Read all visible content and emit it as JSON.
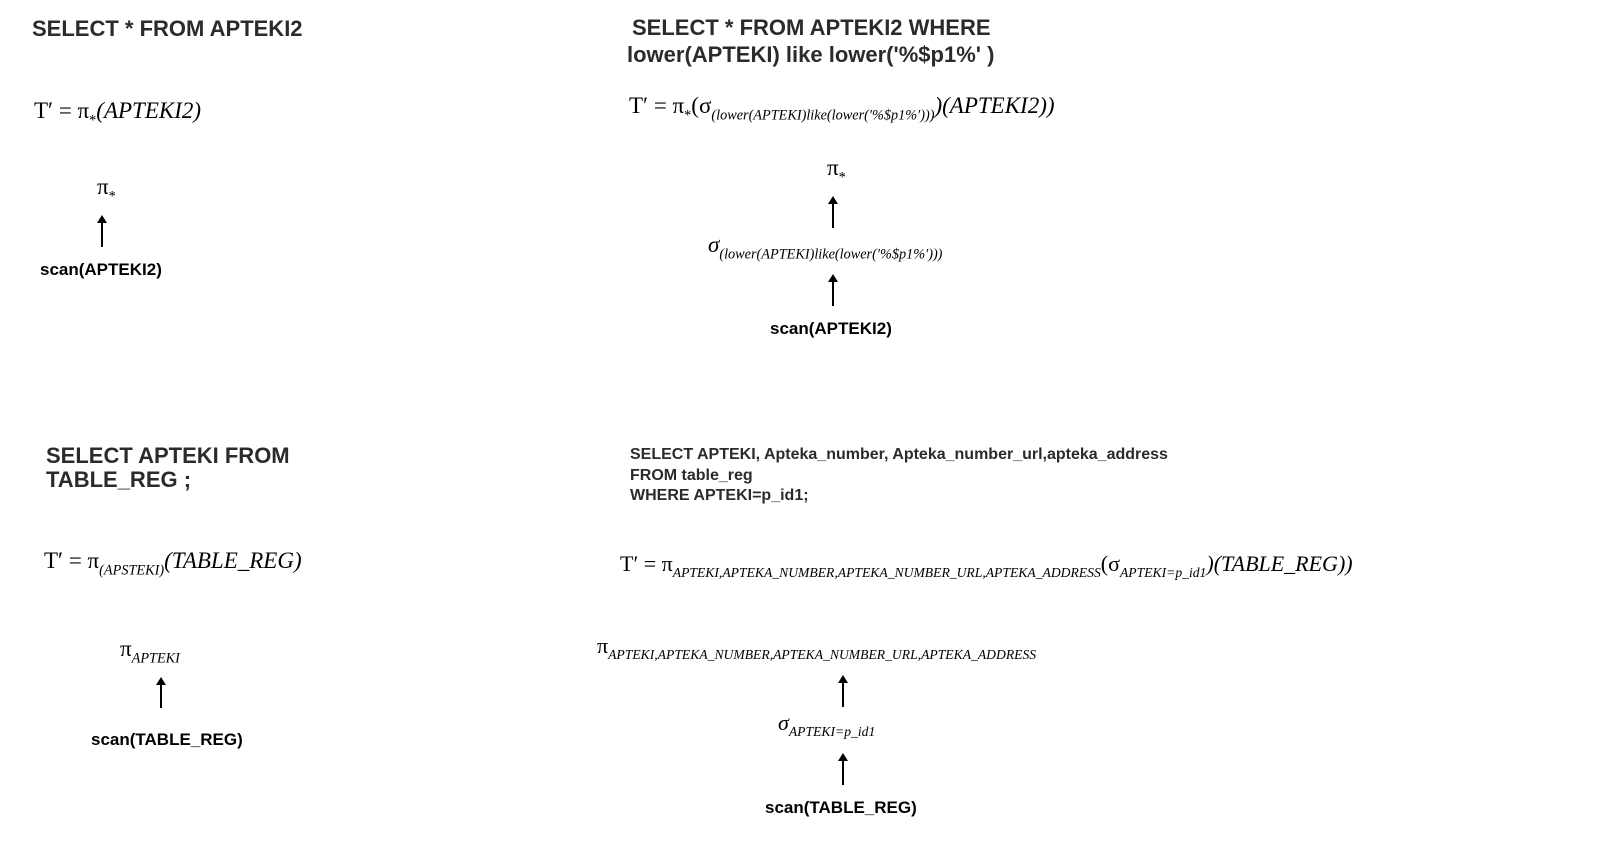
{
  "q1": {
    "sql": "SELECT * FROM APTEKI2",
    "eq": {
      "lhs": "T′ = π",
      "proj_sub": "*",
      "arg": "(APTEKI2)"
    },
    "tree": {
      "proj": "π",
      "proj_sub": "*",
      "scan": "scan(APTEKI2)"
    }
  },
  "q2": {
    "sql_line1": "SELECT * FROM APTEKI2 WHERE",
    "sql_line2": "lower(APTEKI) like lower('%$p1%' )",
    "eq": {
      "lhs": "T′ = π",
      "proj_sub": "*",
      "open": "(σ",
      "sel_sub": "(lower(APTEKI)like(lower(′%$p1%′)))",
      "rest": ")(APTEKI2))"
    },
    "tree": {
      "proj": "π",
      "proj_sub": "*",
      "sel": "σ",
      "sel_sub": "(lower(APTEKI)like(lower(′%$p1%′)))",
      "scan": "scan(APTEKI2)"
    }
  },
  "q3": {
    "sql_line1": "SELECT APTEKI FROM",
    "sql_line2": "TABLE_REG ;",
    "eq": {
      "lhs": "T′ = π",
      "proj_sub": "(APSTEKI)",
      "arg": "(TABLE_REG)"
    },
    "tree": {
      "proj": "π",
      "proj_sub": "APTEKI",
      "scan": "scan(TABLE_REG)"
    }
  },
  "q4": {
    "sql_line1": "SELECT APTEKI, Apteka_number, Apteka_number_url,apteka_address",
    "sql_line2": "FROM table_reg",
    "sql_line3": "WHERE APTEKI=p_id1;",
    "eq": {
      "lhs": "T′ = π",
      "proj_sub": "APTEKI,APTEKA_NUMBER,APTEKA_NUMBER_URL,APTEKA_ADDRESS",
      "open": "(σ",
      "sel_sub": "APTEKI=p_id1",
      "rest": ")(TABLE_REG))"
    },
    "tree": {
      "proj": "π",
      "proj_sub": "APTEKI,APTEKA_NUMBER,APTEKA_NUMBER_URL,APTEKA_ADDRESS",
      "sel": "σ",
      "sel_sub": "APTEKI=p_id1",
      "scan": "scan(TABLE_REG)"
    }
  }
}
